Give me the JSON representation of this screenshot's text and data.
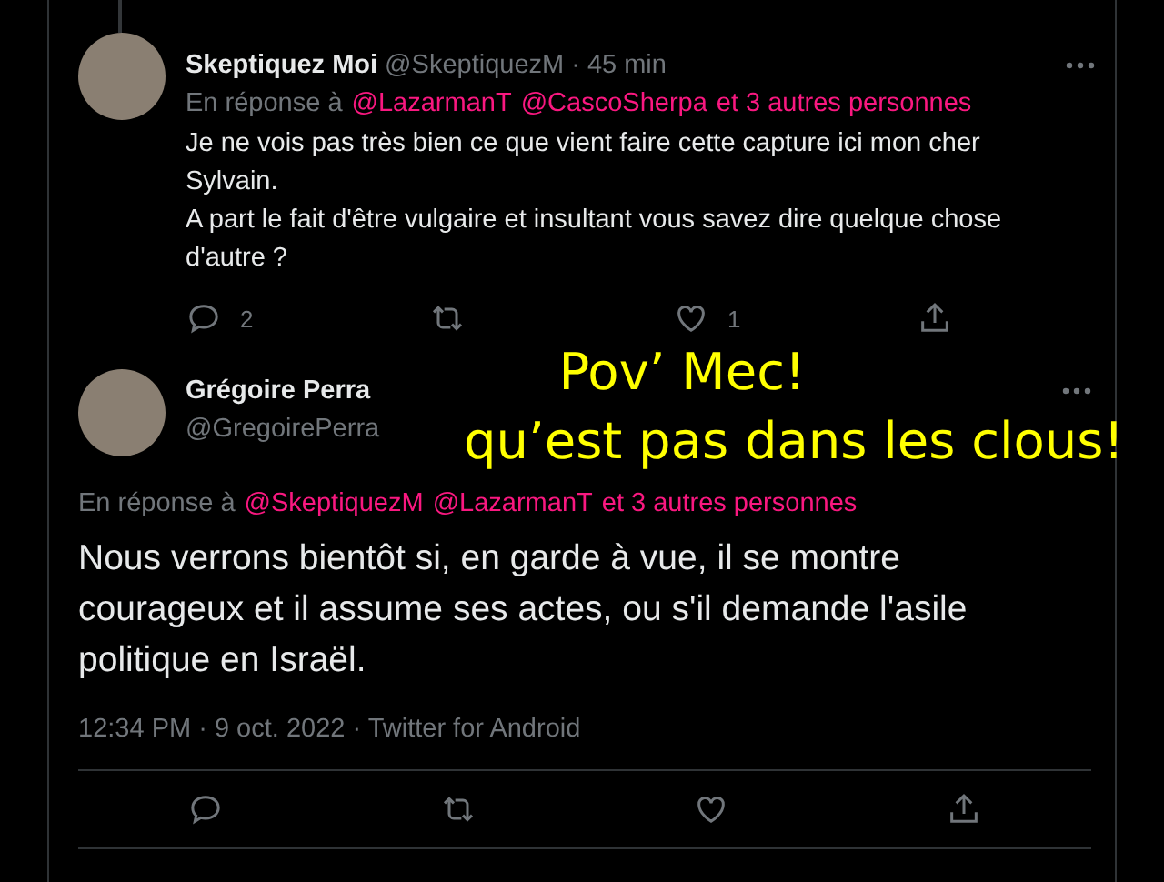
{
  "tweets": [
    {
      "kind": "reply",
      "name": "Skeptiquez Moi",
      "handle": "@SkeptiquezM",
      "time": "· 45 min",
      "reply_prefix": "En réponse à",
      "mentions": [
        "@LazarmanT",
        "@CascoSherpa"
      ],
      "others": "et 3 autres personnes",
      "body": [
        "Je ne vois pas très bien ce que vient faire cette capture ici mon cher Sylvain.",
        "A part le fait d'être vulgaire et insultant vous savez dire quelque chose d'autre ?"
      ],
      "actions": [
        {
          "kind": "reply",
          "count": "2"
        },
        {
          "kind": "retweet"
        },
        {
          "kind": "like",
          "count": "1"
        },
        {
          "kind": "share"
        }
      ]
    },
    {
      "kind": "focused",
      "name": "Grégoire Perra",
      "handle": "@GregoirePerra",
      "reply_prefix": "En réponse à",
      "mentions": [
        "@SkeptiquezM",
        "@LazarmanT"
      ],
      "others": "et 3 autres personnes",
      "body": [
        "Nous verrons bientôt si, en garde à vue, il se montre courageux et il assume ses actes, ou s'il demande l'asile politique en Israël."
      ],
      "meta": "12:34 PM · 9 oct. 2022 · Twitter for Android",
      "actions": [
        {
          "kind": "reply"
        },
        {
          "kind": "retweet"
        },
        {
          "kind": "like"
        },
        {
          "kind": "share"
        }
      ]
    }
  ],
  "overlay": {
    "lines": [
      "Pov’ Mec!",
      "qu’est pas dans les clous!"
    ]
  }
}
